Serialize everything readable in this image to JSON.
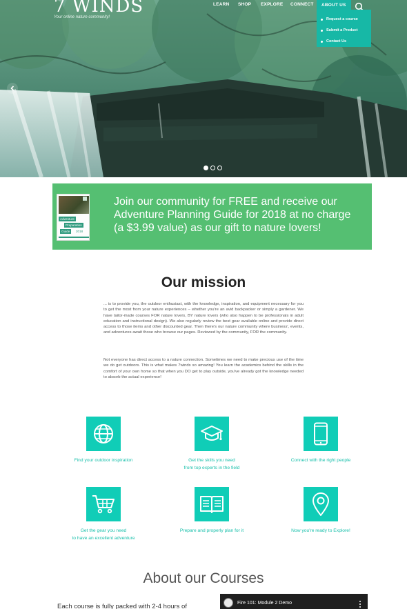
{
  "brand": {
    "title": "7 WINDS",
    "tagline": "Your online nature community!"
  },
  "nav": {
    "items": [
      "LEARN",
      "SHOP",
      "EXPLORE",
      "CONNECT",
      "ABOUT US"
    ],
    "active": "ABOUT US",
    "search_icon": "search-icon",
    "dropdown": [
      "Request a course",
      "Submit a Product",
      "Contact Us"
    ]
  },
  "slider": {
    "slides": 3,
    "active_index": 1
  },
  "promo": {
    "text": "Join our community for FREE and receive our Adventure Planning Guide for 2018 at no charge (a $3.99 value) as our gift to nature lovers!",
    "book": {
      "word1": "Adventure",
      "word2": "Preparation",
      "word3": "Guide",
      "year": "2018"
    }
  },
  "mission": {
    "title": "Our mission",
    "p1": "... is to provide you, the outdoor enthusiast, with the knowledge, inspiration, and equipment necessary for you to get the most from your nature experiences – whether you're an avid backpacker or simply a gardener. We have tailor-made courses FOR nature lovers, BY nature lovers (who also happen to be professionals in adult education and instructional design). We also regularly review the best gear available online and provide direct access to those items and other discounted gear.  Then there's our nature community where business', events, and adventures await those who browse our pages.  Reviewed by the community, FOR the community.",
    "p2": "Not everyone has direct access to a nature connection. Sometimes we need to make precious use of the time we do get outdoors. This is what makes 7winds so amazing! You learn the academics behind the skills in the comfort of your own home so that when you DO get to play outside, you've already got the knowledge needed to absorb the actual experience!"
  },
  "features": [
    {
      "icon": "globe-icon",
      "line1": "Find your outdoor inspiration",
      "line2": ""
    },
    {
      "icon": "graduation-cap-icon",
      "line1": "Get the skills you need",
      "line2": "from top experts in the field"
    },
    {
      "icon": "smartphone-icon",
      "line1": "Connect with the right people",
      "line2": ""
    },
    {
      "icon": "shopping-cart-icon",
      "line1": "Get the gear you need",
      "line2": "to have an excellent adventure"
    },
    {
      "icon": "open-book-icon",
      "line1": "Prepare and properly plan for it",
      "line2": ""
    },
    {
      "icon": "map-pin-icon",
      "line1": "Now you're ready to Explore!",
      "line2": ""
    }
  ],
  "courses": {
    "title": "About our Courses",
    "intro": "Each course is fully packed with 2-4 hours of",
    "video_title": "Fire 101: Module 2 Demo"
  },
  "colors": {
    "teal": "#10cdb7",
    "promo_green": "#55bf72",
    "nav_active": "#18b5a6"
  }
}
